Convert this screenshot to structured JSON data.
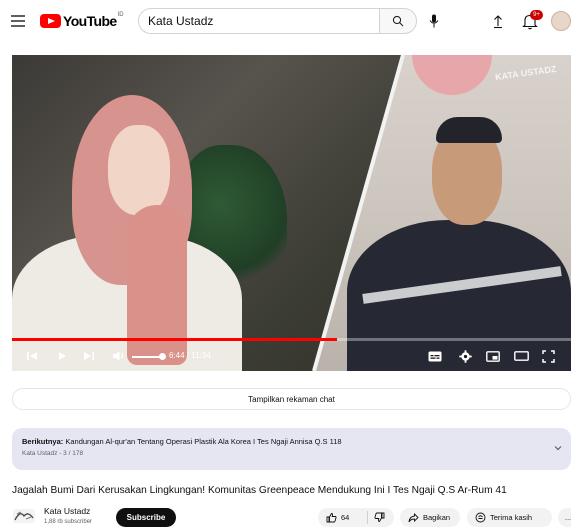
{
  "header": {
    "logo_text": "YouTube",
    "logo_region": "ID",
    "search_value": "Kata Ustadz",
    "notification_count": "9+",
    "icons": [
      "menu-icon",
      "youtube-logo-icon",
      "search-icon",
      "mic-icon",
      "upload-icon",
      "bell-icon",
      "avatar"
    ]
  },
  "player": {
    "watermark": "KATA USTADZ",
    "time_current": "6:44",
    "time_total": "11:34",
    "time_display": "6:44 / 11:34",
    "progress_fraction": 0.582,
    "volume_fraction": 1.0,
    "progress_color": "#ff0000"
  },
  "chat_replay_label": "Tampilkan rekaman chat",
  "up_next": {
    "prefix": "Berikutnya:",
    "title": "Kandungan Al-qur'an Tentang Operasi Plastik Ala Korea I Tes Ngaji Annisa Q.S 118",
    "meta": "Kata Ustadz - 3 / 178"
  },
  "video": {
    "title": "Jagalah Bumi Dari Kerusakan Lingkungan! Komunitas Greenpeace Mendukung Ini I Tes Ngaji Q.S Ar-Rum 41"
  },
  "channel": {
    "name": "Kata Ustadz",
    "subscribers": "1,88 rb subscriber",
    "subscribe_label": "Subscribe"
  },
  "actions": {
    "like_count": "64",
    "share_label": "Bagikan",
    "thanks_label": "Terima kasih",
    "more_label": "..."
  }
}
